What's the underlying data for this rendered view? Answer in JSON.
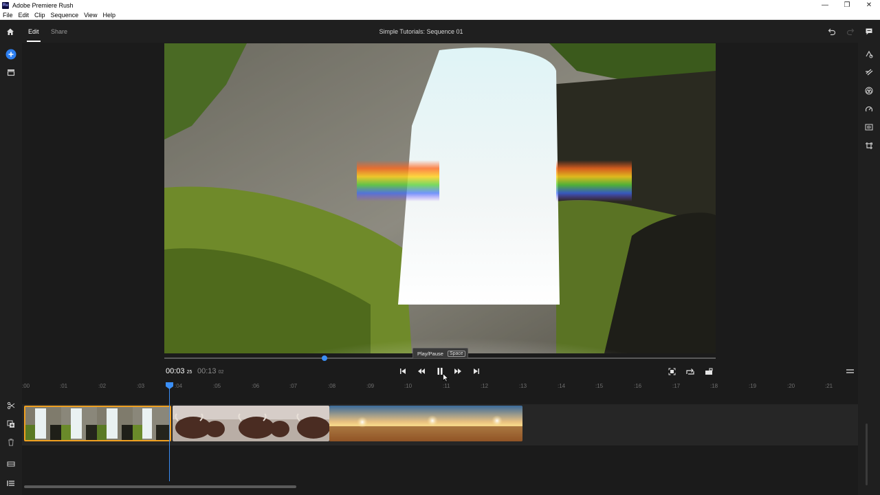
{
  "window": {
    "app_badge": "Ru",
    "title": "Adobe Premiere Rush",
    "controls": [
      "minimize-icon",
      "restore-icon",
      "close-icon"
    ]
  },
  "menu": {
    "items": [
      "File",
      "Edit",
      "Clip",
      "Sequence",
      "View",
      "Help"
    ]
  },
  "topbar": {
    "tabs": [
      {
        "label": "Edit",
        "active": true
      },
      {
        "label": "Share",
        "active": false
      }
    ],
    "sequence_title": "Simple Tutorials: Sequence 01",
    "icons": [
      "home-icon",
      "undo-icon",
      "redo-icon",
      "comment-icon"
    ]
  },
  "left_rail": [
    "add-media-icon",
    "project-panel-icon",
    "split-icon",
    "duplicate-icon",
    "delete-icon",
    "track-options-icon",
    "track-list-icon"
  ],
  "right_rail": [
    "titles-icon",
    "transitions-icon",
    "color-icon",
    "speed-icon",
    "audio-icon",
    "transform-icon"
  ],
  "player": {
    "current_time": "00:03",
    "current_frames": "25",
    "duration": "00:13",
    "duration_frames": "02",
    "progress": 0.29,
    "tooltip": {
      "label": "Play/Pause",
      "shortcut": "Space"
    },
    "controls": [
      "skip-to-start-icon",
      "rewind-icon",
      "pause-icon",
      "fast-forward-icon",
      "skip-to-end-icon"
    ],
    "right_controls": [
      "fit-icon",
      "rotate-icon",
      "aspect-icon"
    ],
    "menu_icon": "hamburger-icon"
  },
  "ruler": {
    "labels": [
      ":00",
      ":01",
      ":02",
      ":03",
      ":04",
      ":05",
      ":06",
      ":07",
      ":08",
      ":09",
      ":10",
      ":11",
      ":12",
      ":13",
      ":14",
      ":15",
      ":16",
      ":17",
      ":18",
      ":19",
      ":20",
      ":21"
    ]
  },
  "timeline": {
    "clips": [
      {
        "name": "waterfall",
        "selected": true
      },
      {
        "name": "highland-cattle",
        "selected": false
      },
      {
        "name": "sunrise-clouds",
        "selected": false
      }
    ],
    "accent_color": "#3a8ef6",
    "selection_color": "#f0a020"
  }
}
